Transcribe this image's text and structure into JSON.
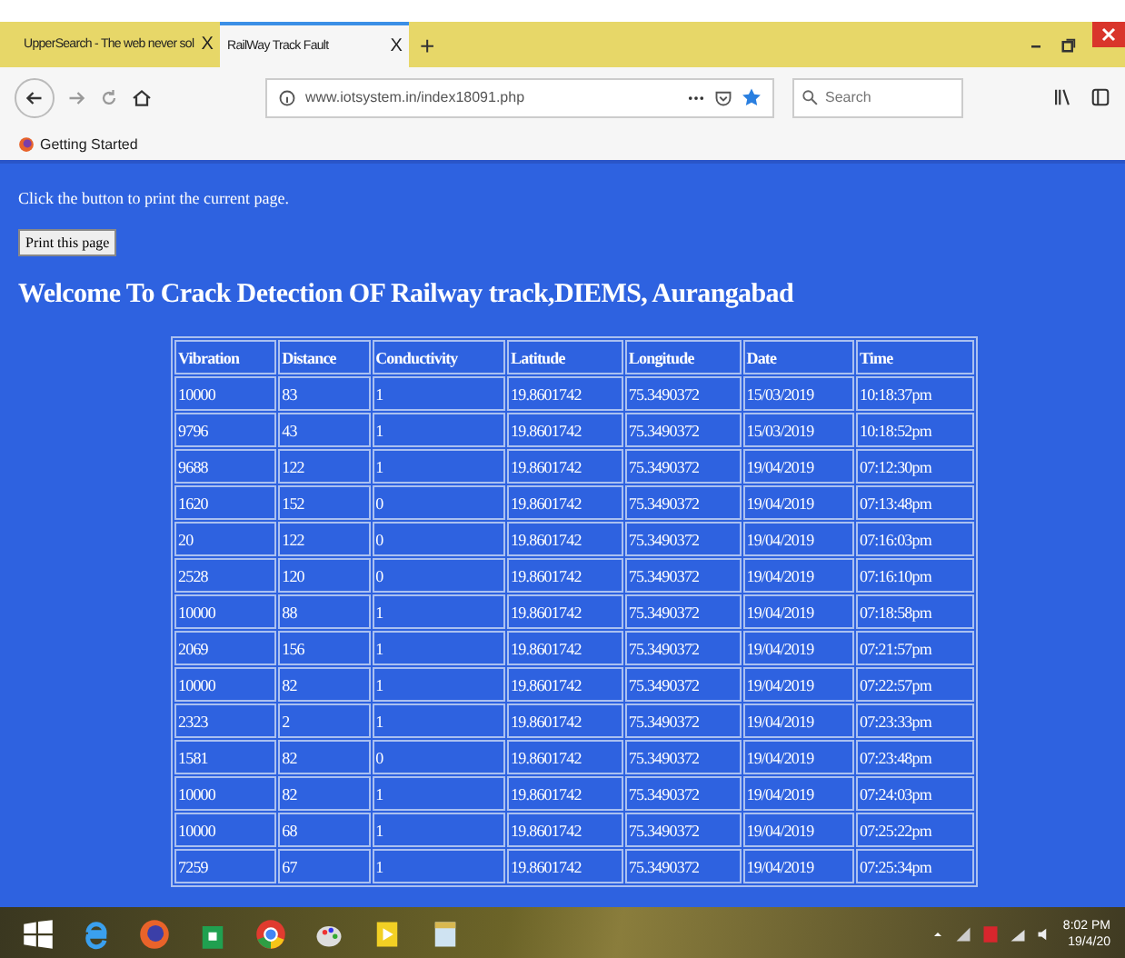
{
  "browser": {
    "tabs": [
      {
        "label": "UpperSearch - The web never sol",
        "selected": false,
        "close": "X"
      },
      {
        "label": "RailWay Track Fault",
        "selected": true,
        "close": "X"
      }
    ],
    "new_tab": "+",
    "url": "www.iotsystem.in/index18091.php",
    "search": {
      "placeholder": "Search"
    },
    "bookmarks": [
      "Getting Started"
    ]
  },
  "page": {
    "instruction": "Click the button to print the current page.",
    "print_button": "Print this page",
    "heading": "Welcome To Crack Detection OF Railway track,DIEMS, Aurangabad",
    "table": {
      "columns": [
        "Vibration",
        "Distance",
        "Conductivity",
        "Latitude",
        "Longitude",
        "Date",
        "Time"
      ],
      "rows": [
        [
          "10000",
          "83",
          "1",
          "19.8601742",
          "75.3490372",
          "15/03/2019",
          "10:18:37pm"
        ],
        [
          "9796",
          "43",
          "1",
          "19.8601742",
          "75.3490372",
          "15/03/2019",
          "10:18:52pm"
        ],
        [
          "9688",
          "122",
          "1",
          "19.8601742",
          "75.3490372",
          "19/04/2019",
          "07:12:30pm"
        ],
        [
          "1620",
          "152",
          "0",
          "19.8601742",
          "75.3490372",
          "19/04/2019",
          "07:13:48pm"
        ],
        [
          "20",
          "122",
          "0",
          "19.8601742",
          "75.3490372",
          "19/04/2019",
          "07:16:03pm"
        ],
        [
          "2528",
          "120",
          "0",
          "19.8601742",
          "75.3490372",
          "19/04/2019",
          "07:16:10pm"
        ],
        [
          "10000",
          "88",
          "1",
          "19.8601742",
          "75.3490372",
          "19/04/2019",
          "07:18:58pm"
        ],
        [
          "2069",
          "156",
          "1",
          "19.8601742",
          "75.3490372",
          "19/04/2019",
          "07:21:57pm"
        ],
        [
          "10000",
          "82",
          "1",
          "19.8601742",
          "75.3490372",
          "19/04/2019",
          "07:22:57pm"
        ],
        [
          "2323",
          "2",
          "1",
          "19.8601742",
          "75.3490372",
          "19/04/2019",
          "07:23:33pm"
        ],
        [
          "1581",
          "82",
          "0",
          "19.8601742",
          "75.3490372",
          "19/04/2019",
          "07:23:48pm"
        ],
        [
          "10000",
          "82",
          "1",
          "19.8601742",
          "75.3490372",
          "19/04/2019",
          "07:24:03pm"
        ],
        [
          "10000",
          "68",
          "1",
          "19.8601742",
          "75.3490372",
          "19/04/2019",
          "07:25:22pm"
        ],
        [
          "7259",
          "67",
          "1",
          "19.8601742",
          "75.3490372",
          "19/04/2019",
          "07:25:34pm"
        ]
      ]
    }
  },
  "taskbar": {
    "clock": {
      "time": "8:02 PM",
      "date": "19/4/20"
    }
  }
}
